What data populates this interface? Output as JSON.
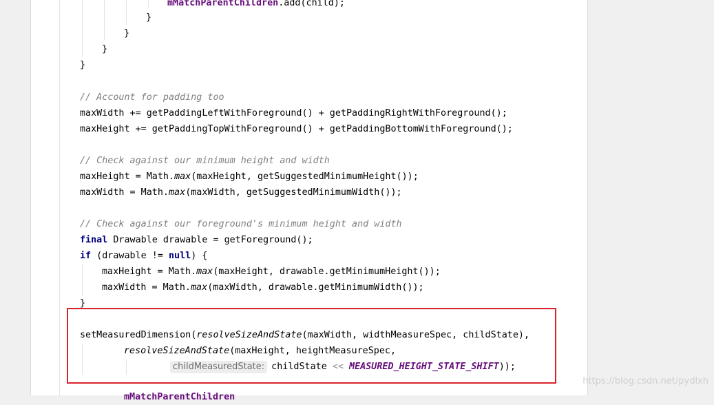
{
  "code": {
    "l0_method": "mMatchParentChildren",
    "l0_rest": ".add(child);",
    "brace_close": "}",
    "comment_padding": "// Account for padding too",
    "pad_w": "maxWidth += getPaddingLeftWithForeground() + getPaddingRightWithForeground();",
    "pad_h": "maxHeight += getPaddingTopWithForeground() + getPaddingBottomWithForeground();",
    "comment_min": "// Check against our minimum height and width",
    "min_h_a": "maxHeight = Math.",
    "min_h_max": "max",
    "min_h_b": "(maxHeight, getSuggestedMinimumHeight());",
    "min_w_a": "maxWidth = Math.",
    "min_w_max": "max",
    "min_w_b": "(maxWidth, getSuggestedMinimumWidth());",
    "comment_fg": "// Check against our foreground's minimum height and width",
    "kw_final": "final",
    "fg_rest": " Drawable drawable = getForeground();",
    "kw_if": "if",
    "if_a": " (drawable != ",
    "kw_null": "null",
    "if_b": ") {",
    "dr_h_a": "maxHeight = Math.",
    "dr_h_max": "max",
    "dr_h_b": "(maxHeight, drawable.getMinimumHeight());",
    "dr_w_a": "maxWidth = Math.",
    "dr_w_max": "max",
    "dr_w_b": "(maxWidth, drawable.getMinimumWidth());",
    "smd_a": "setMeasuredDimension(",
    "smd_fn": "resolveSizeAndState",
    "smd_b": "(maxWidth, widthMeasureSpec, childState),",
    "rs_fn": "resolveSizeAndState",
    "rs_b": "(maxHeight, heightMeasureSpec,",
    "hint_label": "childMeasuredState:",
    "shift_a": "childState ",
    "shift_op": "<<",
    "shift_const": "MEASURED_HEIGHT_STATE_SHIFT",
    "shift_b": "));",
    "partial_method": "mMatchParentChildren"
  },
  "watermark": "https://blog.csdn.net/pydlxh",
  "colors": {
    "keyword": "#000080",
    "comment": "#808080",
    "field": "#660e7a",
    "highlight_box": "#d9232a"
  }
}
